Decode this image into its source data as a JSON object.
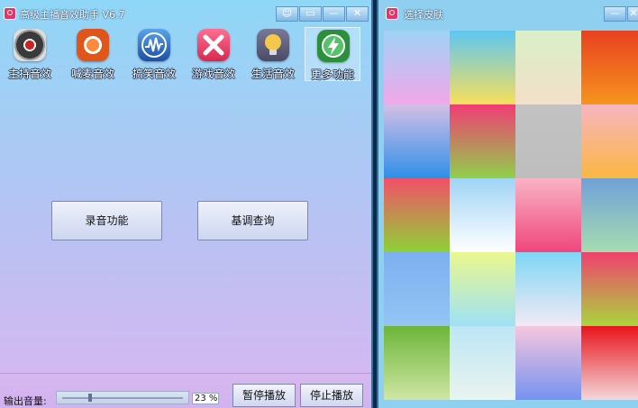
{
  "main_window": {
    "title": "高级主播音效助手  V6.7",
    "controls": {
      "chat": "☺",
      "restore": "▭",
      "minimize": "—",
      "close": "✕"
    },
    "toolbar": [
      {
        "name": "tool-host-effects",
        "label": "主持音效",
        "icon": "record-disc-icon",
        "colors": [
          "#3a3a3a",
          "#cc2222"
        ]
      },
      {
        "name": "tool-cheer-effects",
        "label": "喊麦音效",
        "icon": "target-icon",
        "colors": [
          "#ff8a3c",
          "#e0561a"
        ]
      },
      {
        "name": "tool-funny-effects",
        "label": "搞笑音效",
        "icon": "waveform-icon",
        "colors": [
          "#3b86d8",
          "#1c4fa3"
        ]
      },
      {
        "name": "tool-game-effects",
        "label": "游戏音效",
        "icon": "crossed-x-icon",
        "colors": [
          "#ff4f7a",
          "#d8284f"
        ]
      },
      {
        "name": "tool-life-effects",
        "label": "生活音效",
        "icon": "lightbulb-icon",
        "colors": [
          "#f4c84b",
          "#5a5a78"
        ]
      },
      {
        "name": "tool-more-functions",
        "label": "更多功能",
        "icon": "lightning-icon",
        "colors": [
          "#58c26a",
          "#2c8f3c"
        ]
      }
    ],
    "buttons": {
      "record": "录音功能",
      "base_tone": "基调查询"
    },
    "bottom": {
      "volume_label": "输出音量:",
      "volume_value": "23 %",
      "volume_fraction": 0.23,
      "pause": "暂停播放",
      "stop": "停止播放"
    }
  },
  "skin_window": {
    "title": "选择皮肤",
    "controls": {
      "minimize": "—",
      "close": "✕"
    },
    "swatches": [
      [
        "#9fd3f7",
        "#f1a7e8"
      ],
      [
        "#5ec6f2",
        "#f7e05a"
      ],
      [
        "#d8f0c8",
        "#f4dfc9"
      ],
      [
        "#e8411f",
        "#f6941f"
      ],
      [
        "#d4bfe6",
        "#2e8fe8"
      ],
      [
        "#f13c73",
        "#8fd04a"
      ],
      [
        "#c2c2c2",
        "#bebebe"
      ],
      [
        "#f7b6c0",
        "#fbb640"
      ],
      [
        "#f25068",
        "#8ed136"
      ],
      [
        "#9fd3f5",
        "#ffffff"
      ],
      [
        "#f8b3c4",
        "#f0467d"
      ],
      [
        "#6fa1d8",
        "#a6dcb0"
      ],
      [
        "#7db0f0",
        "#93c4f4"
      ],
      [
        "#eaf78d",
        "#9ee2f5"
      ],
      [
        "#7fd6f3",
        "#f2e9f5"
      ],
      [
        "#f0406e",
        "#a9d63c"
      ],
      [
        "#6cb53a",
        "#cfe6a3"
      ],
      [
        "#bde6f5",
        "#eaf4ee"
      ],
      [
        "#f7c6de",
        "#7593f0"
      ],
      [
        "#e8141c",
        "#f2d8da"
      ]
    ]
  }
}
